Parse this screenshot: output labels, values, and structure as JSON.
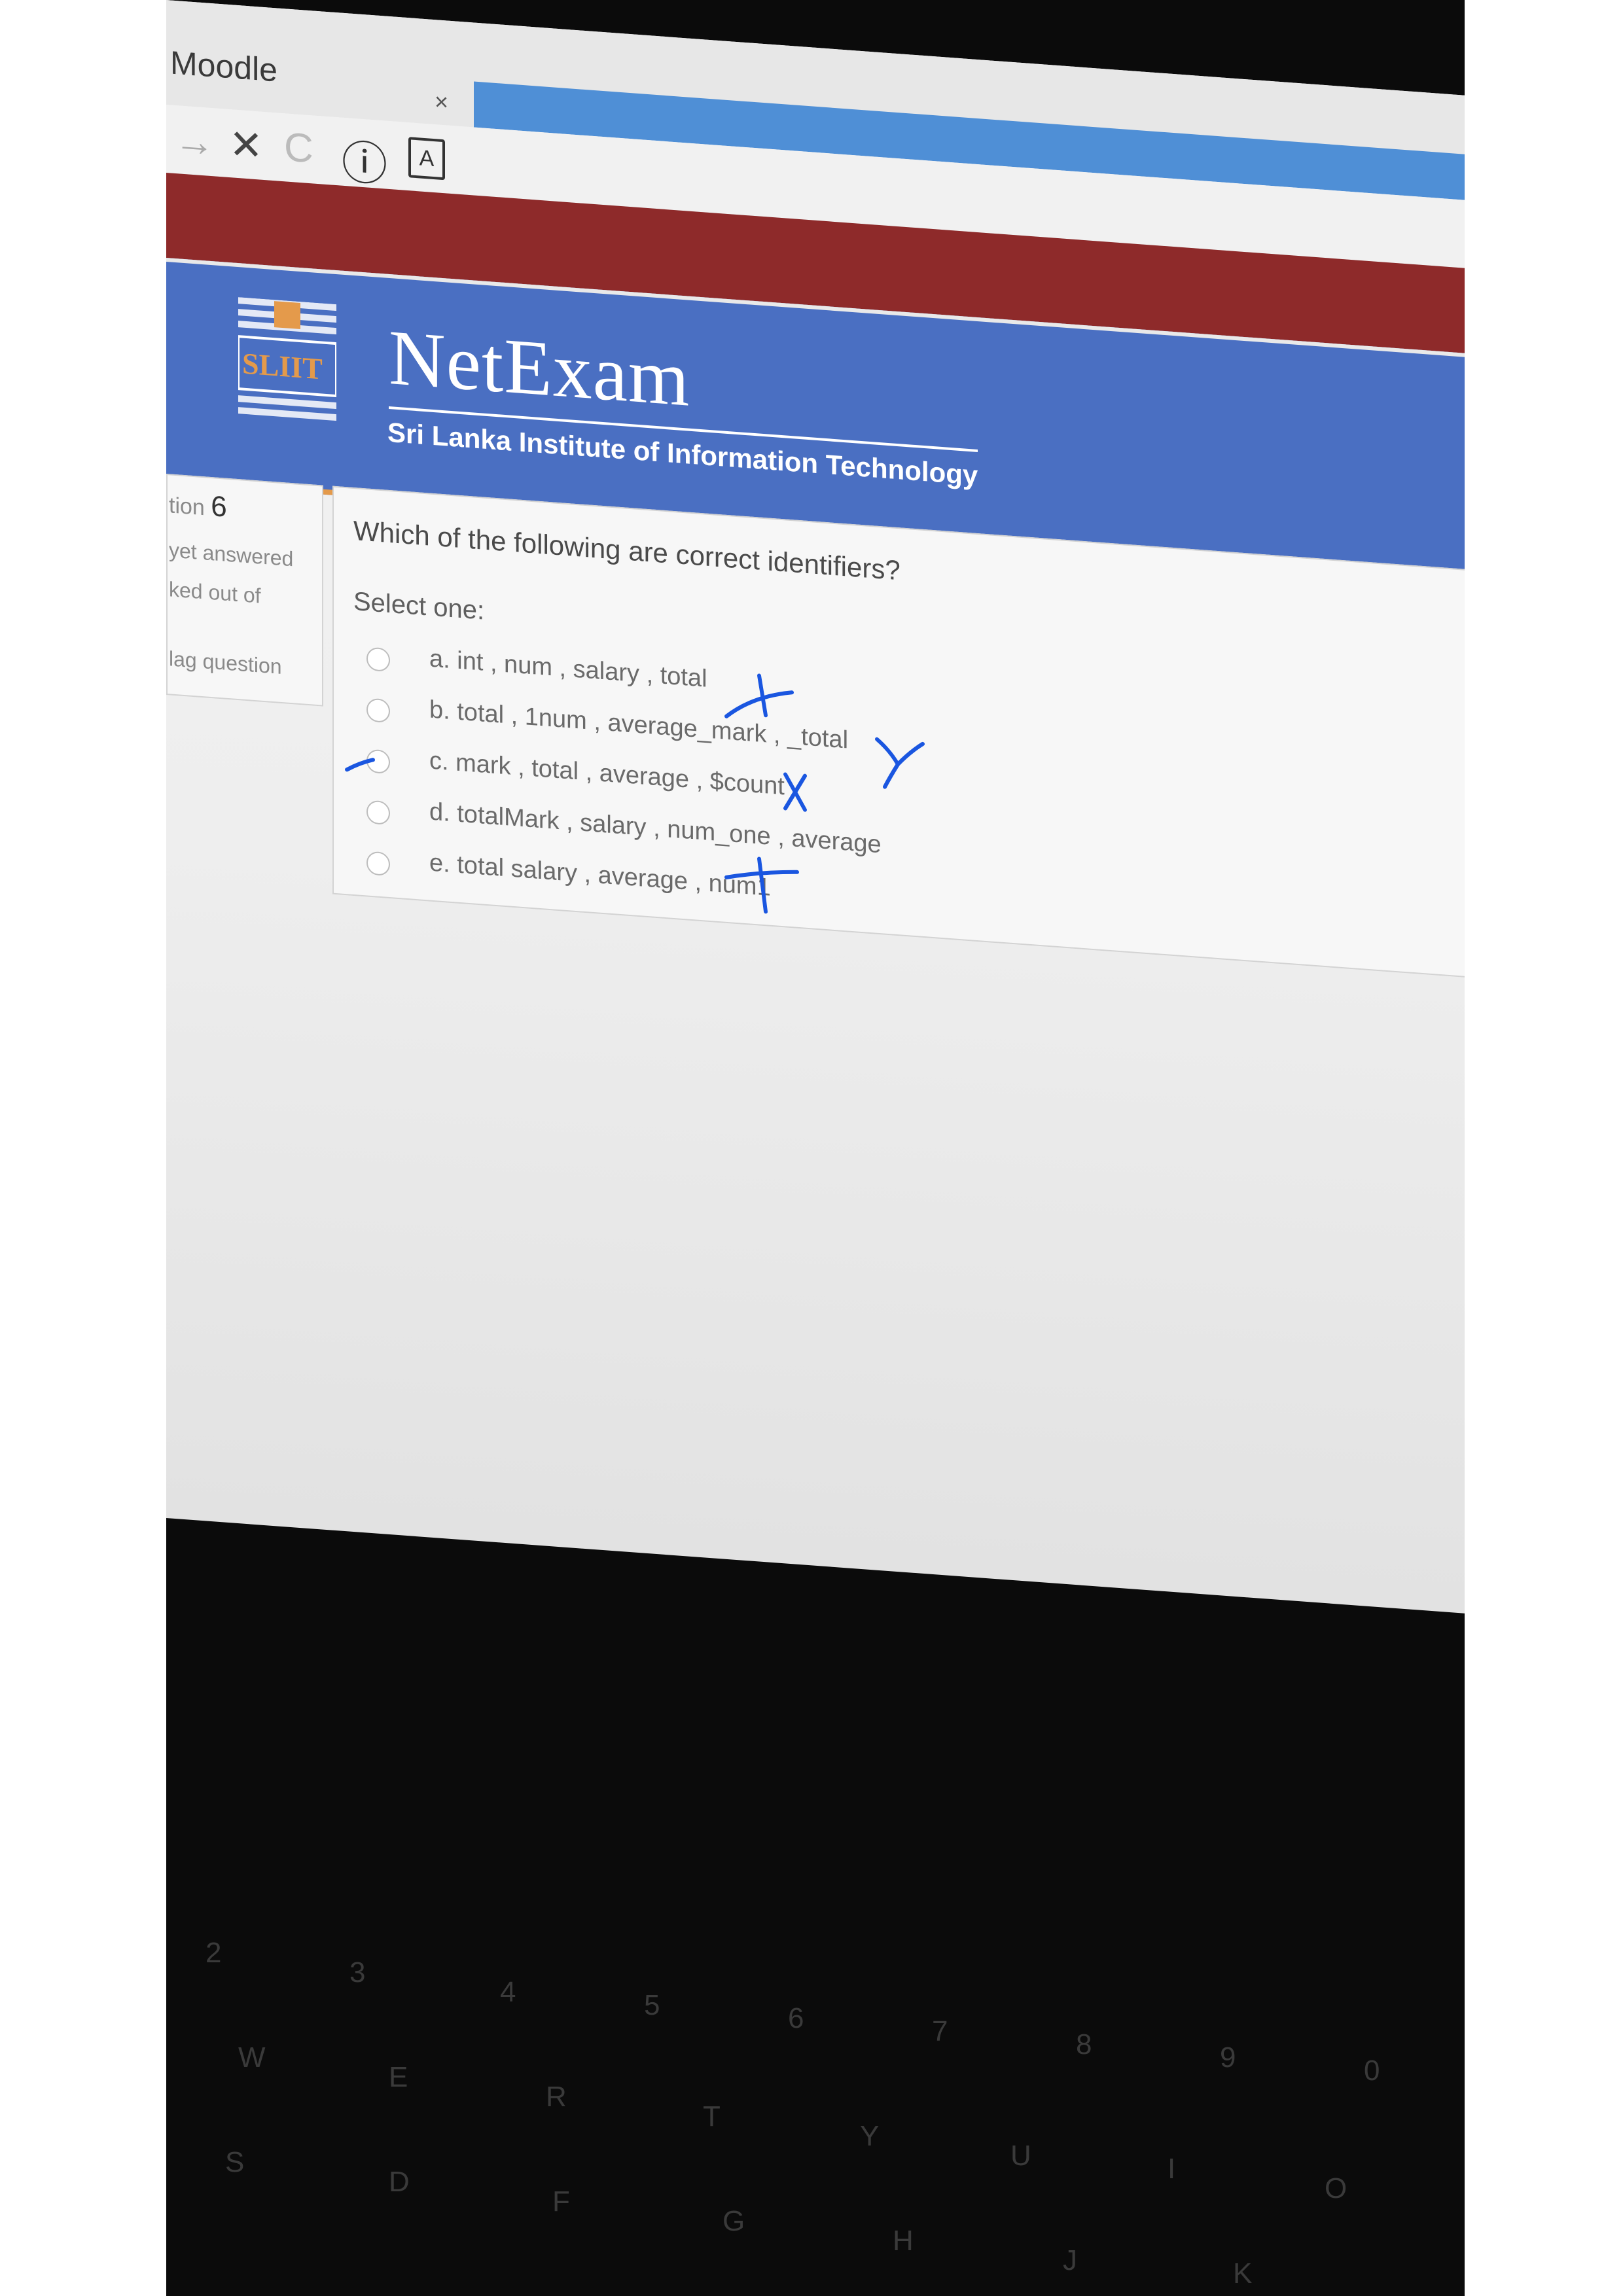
{
  "browser": {
    "tab_title": "Moodle",
    "tab_close": "×",
    "nav": {
      "back": "→",
      "stop": "✕",
      "reload": "C",
      "info": "ⓘ",
      "pdf": "A"
    }
  },
  "header": {
    "logo_text": "SLIIT",
    "title": "NetExam",
    "subtitle": "Sri Lanka Institute of Information Technology"
  },
  "question_info": {
    "number_label": "tion",
    "number": "6",
    "status": "yet answered",
    "marked": "ked out of",
    "flag": "lag question"
  },
  "question": {
    "text": "Which of the following are correct identifiers?",
    "prompt": "Select one:",
    "options": [
      {
        "label": "a. int , num , salary , total"
      },
      {
        "label": "b. total , 1num , average_mark , _total"
      },
      {
        "label": "c. mark , total , average , $count"
      },
      {
        "label": "d. totalMark , salary , num_one , average"
      },
      {
        "label": "e. total salary , average , num1"
      }
    ]
  },
  "annotations": {
    "color": "#1a56e0"
  },
  "keyboard": {
    "row1": [
      "2",
      "3",
      "4",
      "5",
      "6",
      "7",
      "8",
      "9",
      "0"
    ],
    "row2": [
      "W",
      "E",
      "R",
      "T",
      "Y",
      "U",
      "I",
      "O"
    ],
    "row3": [
      "S",
      "D",
      "F",
      "G",
      "H",
      "J",
      "K"
    ]
  }
}
